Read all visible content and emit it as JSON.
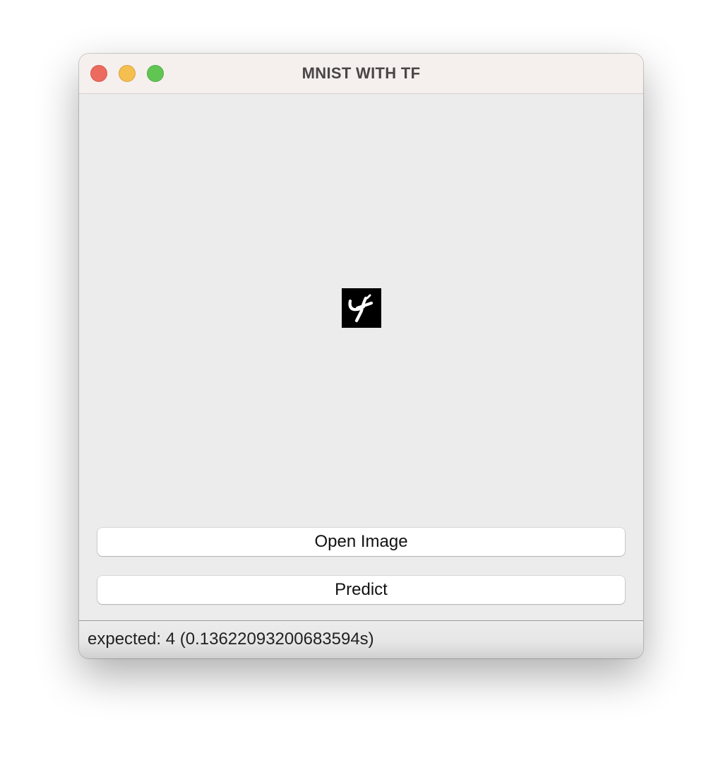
{
  "window": {
    "title": "MNIST WITH TF"
  },
  "preview": {
    "icon": "mnist-digit-image",
    "background": "#000000",
    "stroke": "#ffffff"
  },
  "buttons": {
    "open_label": "Open Image",
    "predict_label": "Predict"
  },
  "status": {
    "text": "expected: 4 (0.13622093200683594s)"
  }
}
